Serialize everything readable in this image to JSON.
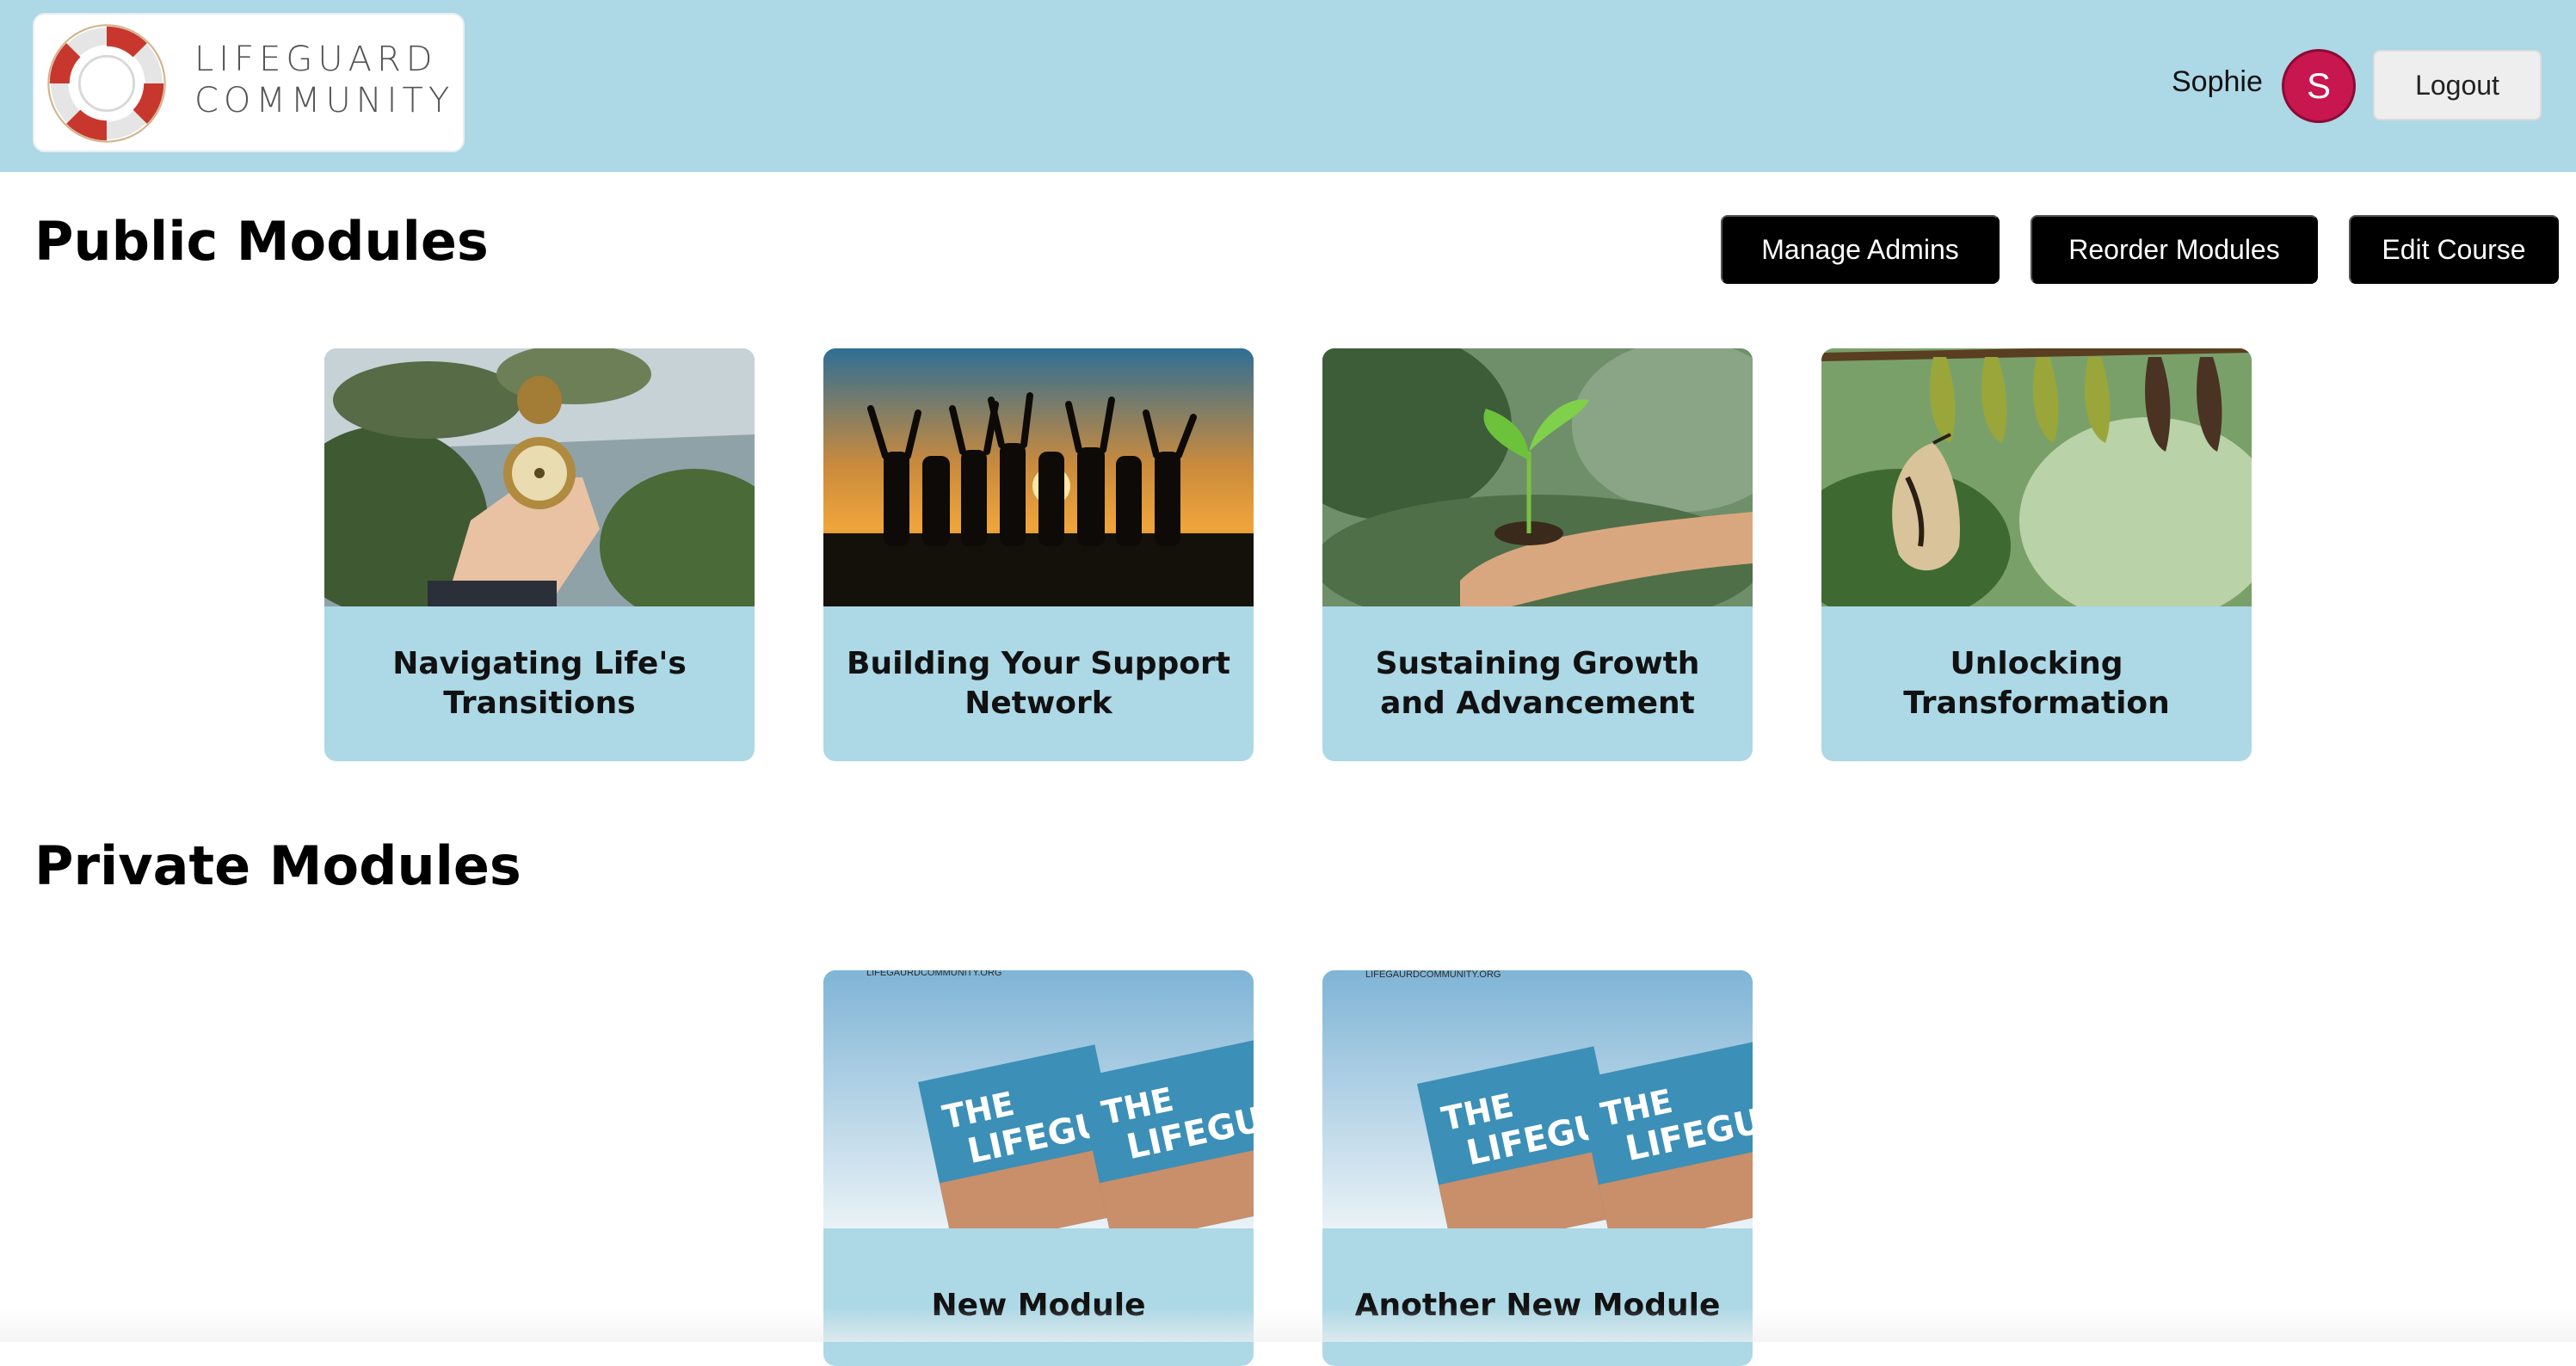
{
  "header": {
    "logo_line1": "LIFEGUARD",
    "logo_line2": "COMMUNITY",
    "user_name": "Sophie",
    "avatar_initial": "S",
    "logout_label": "Logout",
    "background_color": "#add8e6",
    "avatar_color": "#c8164f"
  },
  "public_section": {
    "title": "Public Modules",
    "actions": {
      "manage_admins": "Manage Admins",
      "reorder_modules": "Reorder Modules",
      "edit_course": "Edit Course"
    },
    "modules": [
      {
        "title": "Navigating Life's Transitions",
        "image": "hand-holding-compass-photo"
      },
      {
        "title": "Building Your Support Network",
        "image": "group-silhouette-sunset-photo"
      },
      {
        "title": "Sustaining Growth and Advancement",
        "image": "hand-holding-seedling-photo"
      },
      {
        "title": "Unlocking Transformation",
        "image": "butterfly-chrysalis-photo"
      }
    ]
  },
  "private_section": {
    "title": "Private Modules",
    "modules": [
      {
        "title": "New Module",
        "image": "lifeguard-book-cover",
        "cover_url_text": "LIFEGAURDCOMMUNITY.ORG",
        "book_title_1": "THE",
        "book_title_2": "LIFEGUARD"
      },
      {
        "title": "Another New Module",
        "image": "lifeguard-book-cover",
        "cover_url_text": "LIFEGAURDCOMMUNITY.ORG",
        "book_title_1": "THE",
        "book_title_2": "LIFEGUARD"
      }
    ]
  },
  "colors": {
    "card_background": "#add8e6",
    "action_button": "#000000"
  }
}
